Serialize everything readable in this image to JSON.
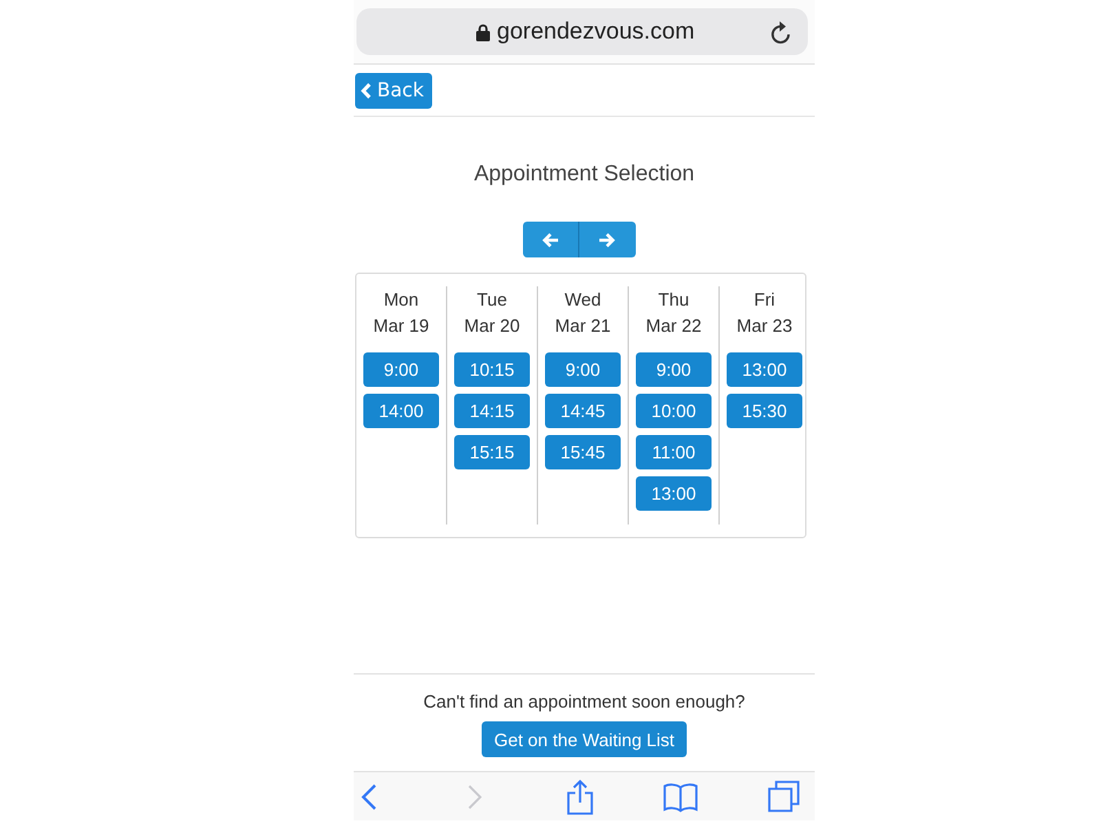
{
  "browser": {
    "url": "gorendezvous.com"
  },
  "header": {
    "back_button": "Back"
  },
  "title": "Appointment Selection",
  "days": [
    {
      "weekday": "Mon",
      "date": "Mar 19",
      "slots": [
        "9:00",
        "14:00"
      ]
    },
    {
      "weekday": "Tue",
      "date": "Mar 20",
      "slots": [
        "10:15",
        "14:15",
        "15:15"
      ]
    },
    {
      "weekday": "Wed",
      "date": "Mar 21",
      "slots": [
        "9:00",
        "14:45",
        "15:45"
      ]
    },
    {
      "weekday": "Thu",
      "date": "Mar 22",
      "slots": [
        "9:00",
        "10:00",
        "11:00",
        "13:00"
      ]
    },
    {
      "weekday": "Fri",
      "date": "Mar 23",
      "slots": [
        "13:00",
        "15:30"
      ]
    }
  ],
  "footer": {
    "prompt": "Can't find an appointment soon enough?",
    "button": "Get on the Waiting List"
  },
  "toolbar": {
    "back": {
      "disabled": false
    },
    "forward": {
      "disabled": true
    }
  }
}
